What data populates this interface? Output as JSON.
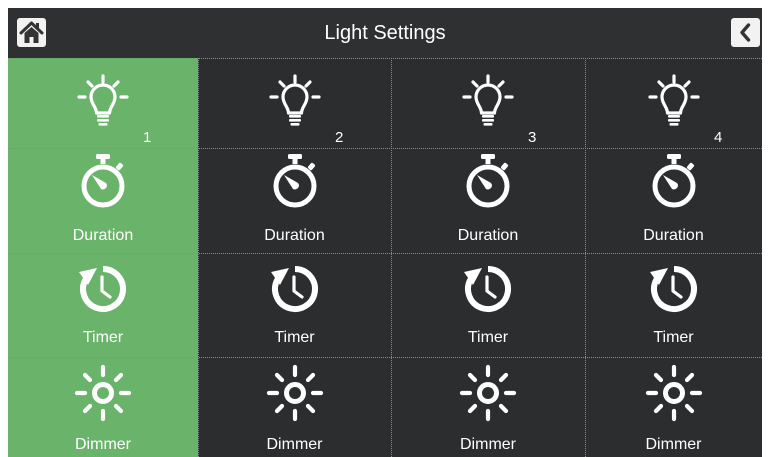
{
  "header": {
    "title": "Light Settings",
    "home_icon": "home-icon",
    "back_icon": "back-chevron-icon"
  },
  "selected_light": 1,
  "lights": [
    {
      "number": "1",
      "duration_label": "Duration",
      "timer_label": "Timer",
      "dimmer_label": "Dimmer"
    },
    {
      "number": "2",
      "duration_label": "Duration",
      "timer_label": "Timer",
      "dimmer_label": "Dimmer"
    },
    {
      "number": "3",
      "duration_label": "Duration",
      "timer_label": "Timer",
      "dimmer_label": "Dimmer"
    },
    {
      "number": "4",
      "duration_label": "Duration",
      "timer_label": "Timer",
      "dimmer_label": "Dimmer"
    }
  ],
  "icons": {
    "light": "bulb-icon",
    "duration": "stopwatch-icon",
    "timer": "timer-icon",
    "dimmer": "sun-icon"
  },
  "colors": {
    "active": "#6ab36b",
    "background": "#2b2d2f",
    "text": "#ffffff"
  }
}
